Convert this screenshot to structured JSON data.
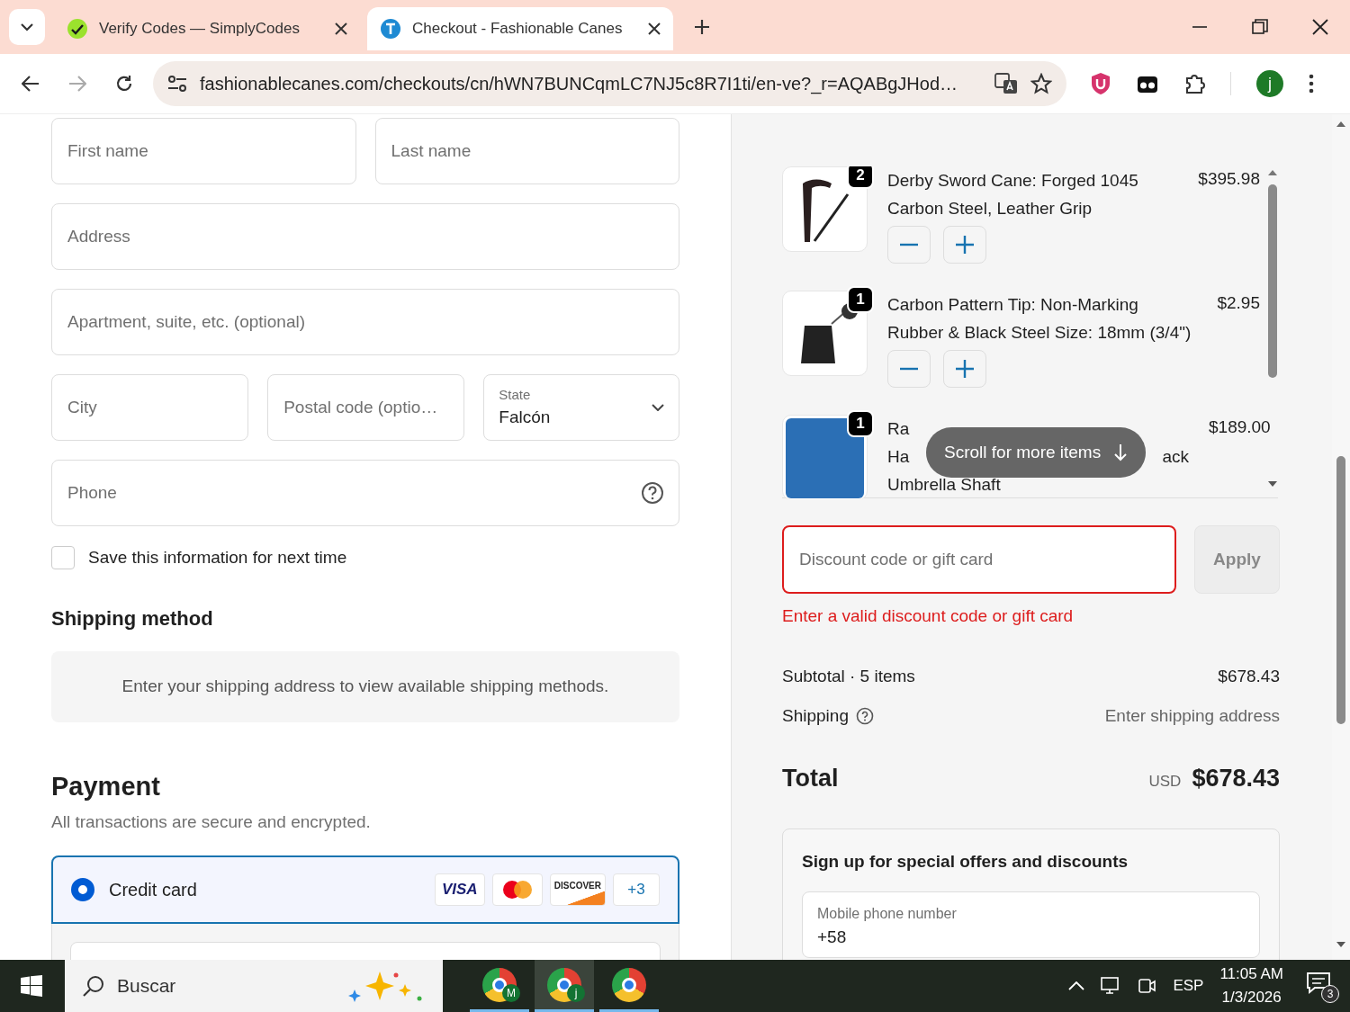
{
  "browser": {
    "tabs": [
      {
        "title": "Verify Codes — SimplyCodes",
        "selected": false
      },
      {
        "title": "Checkout - Fashionable Canes",
        "selected": true
      }
    ],
    "url": "fashionablecanes.com/checkouts/cn/hWN7BUNCqmLC7NJ5c8R7I1ti/en-ve?_r=AQABgJHod…",
    "profile_initial": "j"
  },
  "form": {
    "rows": [
      [
        {
          "kind": "text",
          "placeholder": "First name"
        },
        {
          "kind": "text",
          "placeholder": "Last name"
        }
      ],
      [
        {
          "kind": "text",
          "placeholder": "Address"
        }
      ],
      [
        {
          "kind": "text",
          "placeholder": "Apartment, suite, etc. (optional)"
        }
      ],
      [
        {
          "kind": "text",
          "placeholder": "City"
        },
        {
          "kind": "text",
          "placeholder": "Postal code (optio…"
        },
        {
          "kind": "select",
          "label": "State",
          "value": "Falcón"
        }
      ],
      [
        {
          "kind": "help",
          "placeholder": "Phone"
        }
      ]
    ],
    "save_info": {
      "label": "Save this information for next time",
      "checked": false
    }
  },
  "shipping_method": {
    "heading": "Shipping method",
    "message": "Enter your shipping address to view available shipping methods."
  },
  "payment": {
    "heading": "Payment",
    "subtitle": "All transactions are secure and encrypted.",
    "methods": [
      {
        "label": "Credit card",
        "selected": true,
        "brands": [
          {
            "kind": "visa",
            "text": "VISA"
          },
          {
            "kind": "mastercard"
          },
          {
            "kind": "discover",
            "text": "DISCOVER"
          }
        ],
        "more": "+3"
      }
    ]
  },
  "summary": {
    "items": [
      {
        "kind": "full",
        "quantity": "2",
        "title": "Derby Sword Cane: Forged 1045 Carbon Steel, Leather Grip",
        "price": "$395.98"
      },
      {
        "kind": "full",
        "quantity": "1",
        "title": "Carbon Pattern Tip: Non-Marking Rubber & Black Steel Size: 18mm (3/4\")",
        "price": "$2.95"
      },
      {
        "kind": "obscured",
        "quantity": "1",
        "title_parts": [
          "Ra",
          "Ha",
          "ack",
          "Umbrella Shaft"
        ],
        "price": "$189.00"
      }
    ],
    "scroll_hint": "Scroll for more items",
    "discount": {
      "placeholder": "Discount code or gift card",
      "invalid": true,
      "error": "Enter a valid discount code or gift card",
      "button": "Apply",
      "button_disabled": true
    },
    "subtotal": {
      "label": "Subtotal · 5 items",
      "value": "$678.43"
    },
    "shipping": {
      "label": "Shipping",
      "value": "Enter shipping address"
    },
    "total": {
      "label": "Total",
      "currency": "USD",
      "value": "$678.43"
    },
    "signup": {
      "heading": "Sign up for special offers and discounts",
      "field_label": "Mobile phone number",
      "field_value": "+58"
    }
  },
  "taskbar": {
    "search": "Buscar",
    "apps": [
      {
        "badge": "M",
        "selected": false
      },
      {
        "badge": "j",
        "selected": true
      },
      {
        "selected": false
      }
    ],
    "language": "ESP",
    "time": "11:05 AM",
    "date": "1/3/2026",
    "notifications": "3"
  }
}
